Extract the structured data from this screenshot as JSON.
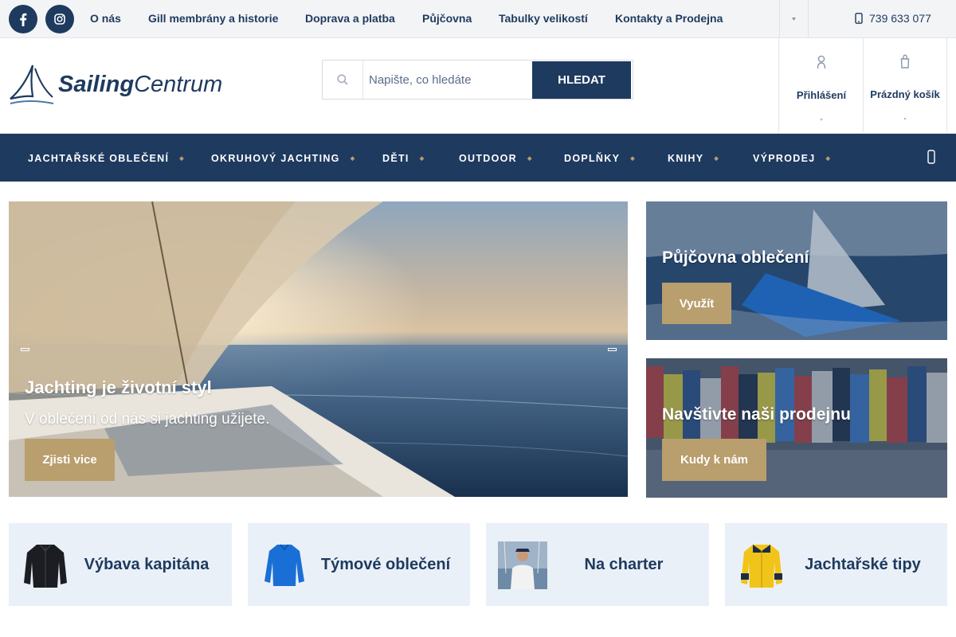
{
  "topbar": {
    "nav": [
      "O nás",
      "Gill membrány a historie",
      "Doprava a platba",
      "Půjčovna",
      "Tabulky velikostí",
      "Kontakty a Prodejna"
    ],
    "phone": "739 633 077"
  },
  "logo": {
    "bold": "Sailing",
    "light": "Centrum"
  },
  "search": {
    "placeholder": "Napište, co hledáte",
    "button": "Hledat"
  },
  "account": {
    "login": "Přihlášení",
    "cart": "Prázdný košík"
  },
  "mainnav": [
    "Jachtařské oblečení",
    "Okruhový jachting",
    "Děti",
    "Outdoor",
    "Doplňky",
    "Knihy",
    "Výprodej"
  ],
  "hero": {
    "title": "Jachting je životní styl",
    "subtitle": "V oblečení od nás si jachting užijete.",
    "button": "Zjisti vice"
  },
  "promos": [
    {
      "title": "Půjčovna oblečení",
      "button": "Využít"
    },
    {
      "title": "Navštivte naši prodejnu",
      "button": "Kudy k nám"
    }
  ],
  "tiles": [
    "Výbava kapitána",
    "Týmové oblečení",
    "Na charter",
    "Jachtařské tipy"
  ],
  "colors": {
    "navy": "#1e3a5f",
    "gold": "#b99e6e",
    "tile_bg": "#eaf0f7",
    "topbar_bg": "#f3f4f6"
  },
  "icons": [
    "facebook-icon",
    "instagram-icon",
    "phone-icon",
    "search-icon",
    "user-icon",
    "cart-icon",
    "chevron-down-icon"
  ]
}
